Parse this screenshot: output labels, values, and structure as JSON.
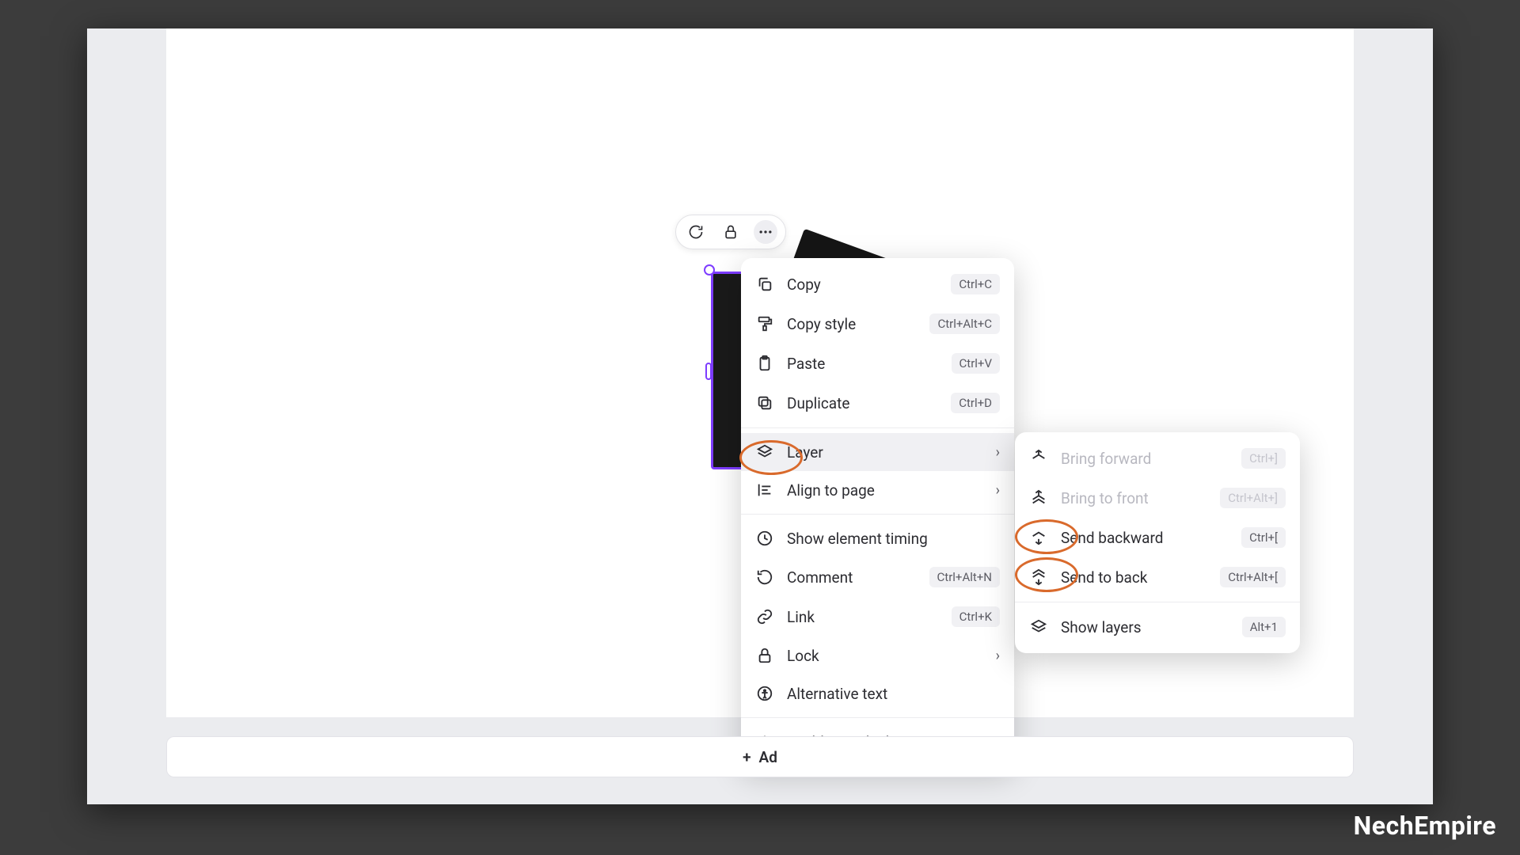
{
  "toolbar": {
    "rotate_icon": "rotate",
    "lock_icon": "lock",
    "more_icon": "more"
  },
  "context_menu": {
    "copy": {
      "label": "Copy",
      "shortcut": "Ctrl+C"
    },
    "copy_style": {
      "label": "Copy style",
      "shortcut": "Ctrl+Alt+C"
    },
    "paste": {
      "label": "Paste",
      "shortcut": "Ctrl+V"
    },
    "duplicate": {
      "label": "Duplicate",
      "shortcut": "Ctrl+D"
    },
    "layer": {
      "label": "Layer"
    },
    "align": {
      "label": "Align to page"
    },
    "timing": {
      "label": "Show element timing"
    },
    "comment": {
      "label": "Comment",
      "shortcut": "Ctrl+Alt+N"
    },
    "link": {
      "label": "Link",
      "shortcut": "Ctrl+K"
    },
    "lock": {
      "label": "Lock"
    },
    "alt_text": {
      "label": "Alternative text"
    },
    "quick_flow": {
      "label": "Enable Quick Flow"
    }
  },
  "layer_submenu": {
    "bring_forward": {
      "label": "Bring forward",
      "shortcut": "Ctrl+]"
    },
    "bring_front": {
      "label": "Bring to front",
      "shortcut": "Ctrl+Alt+]"
    },
    "send_backward": {
      "label": "Send backward",
      "shortcut": "Ctrl+["
    },
    "send_back": {
      "label": "Send to back",
      "shortcut": "Ctrl+Alt+["
    },
    "show_layers": {
      "label": "Show layers",
      "shortcut": "Alt+1"
    }
  },
  "add_page": {
    "label": "Ad",
    "plus": "+"
  },
  "watermark": "NechEmpire"
}
